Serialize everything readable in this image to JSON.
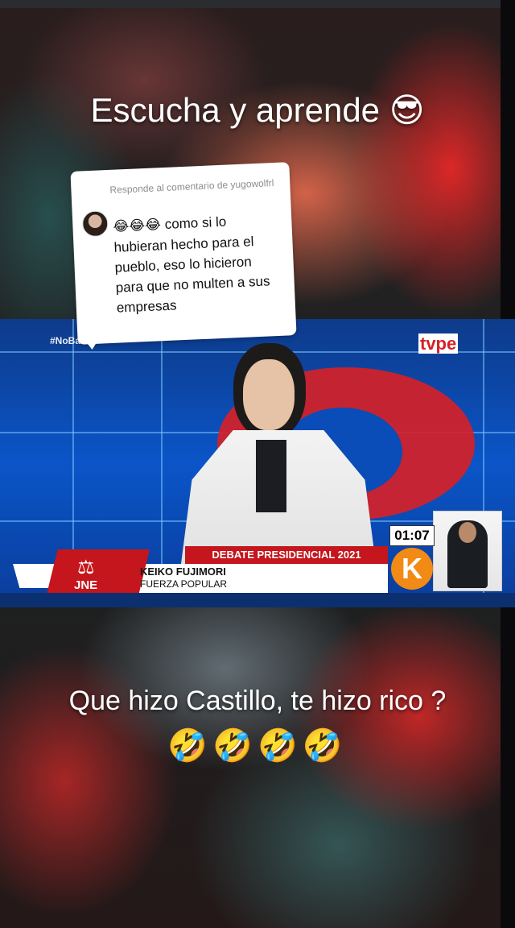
{
  "caption_top": {
    "text": "Escucha y aprende",
    "emoji": "😎"
  },
  "comment": {
    "reply_header": "Responde al comentario de yugowolfrl",
    "emoji_prefix": "😂😂😂",
    "text": "como si lo hubieran hecho para el pueblo, eso lo hicieron para que no multen a sus empresas"
  },
  "video": {
    "hashtag": "#NoBa",
    "channel_logo": "tvpe",
    "debate_title": "DEBATE PRESIDENCIAL 2021",
    "speaker_name": "KEIKO FUJIMORI",
    "speaker_party": "FUERZA POPULAR",
    "organizer": "JNE",
    "timer": "01:07",
    "party_letter": "K"
  },
  "caption_bottom": {
    "text": "Que hizo Castillo, te hizo rico ?",
    "emoji_row": "🤣🤣🤣🤣"
  },
  "colors": {
    "debate_red": "#c4161c",
    "party_orange": "#f28a16",
    "studio_blue": "#0a55c8"
  }
}
